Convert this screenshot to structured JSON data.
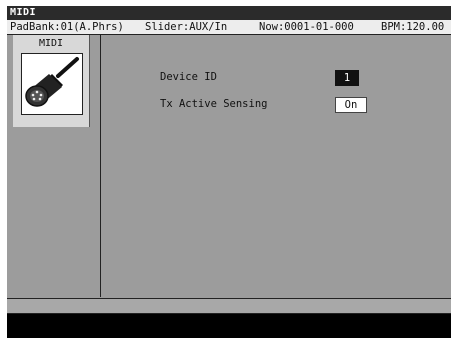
{
  "window": {
    "title": "MIDI"
  },
  "status": {
    "padbank": "PadBank:01(A.Phrs)",
    "slider": "Slider:AUX/In",
    "now": "Now:0001-01-000",
    "bpm": "BPM:120.00"
  },
  "sidebar": {
    "label": "MIDI",
    "icon": "midi-connector-icon"
  },
  "params": [
    {
      "label": "Device ID",
      "value": "1"
    },
    {
      "label": "Tx Active Sensing",
      "value": "On"
    }
  ],
  "message": ""
}
